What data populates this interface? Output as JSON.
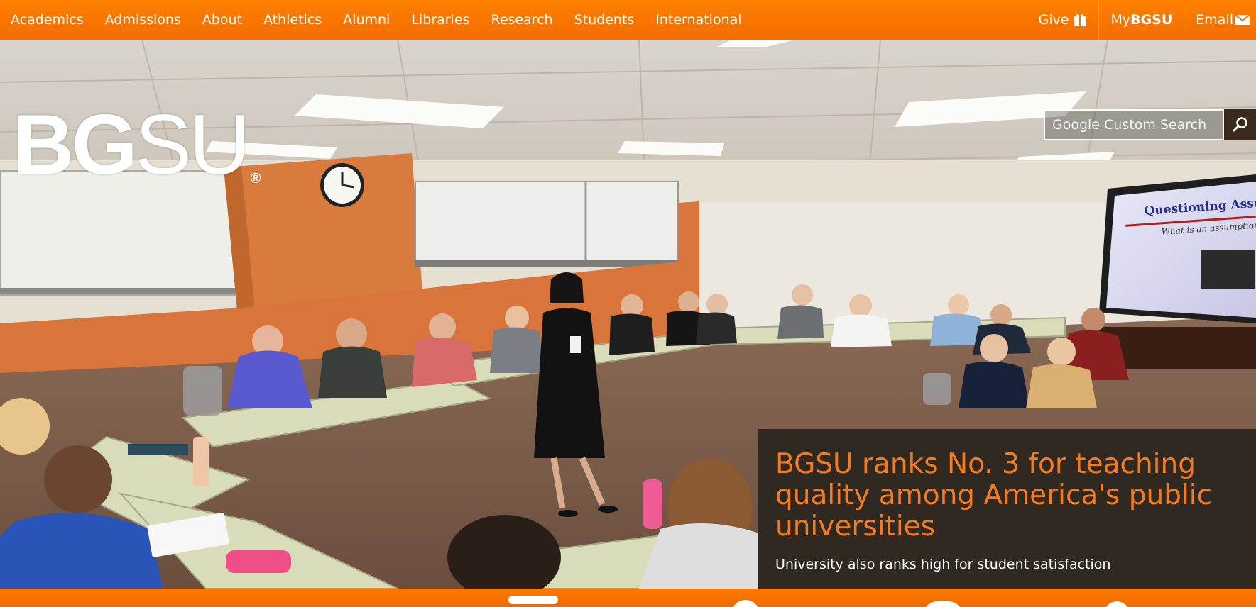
{
  "nav": {
    "left": [
      {
        "label": "Academics"
      },
      {
        "label": "Admissions"
      },
      {
        "label": "About"
      },
      {
        "label": "Athletics"
      },
      {
        "label": "Alumni"
      },
      {
        "label": "Libraries"
      },
      {
        "label": "Research"
      },
      {
        "label": "Students"
      },
      {
        "label": "International"
      }
    ],
    "right": {
      "give_label": "Give",
      "give_icon": "gift-icon",
      "my_prefix": "My",
      "my_strong": "BGSU",
      "email_label": "Email",
      "email_icon": "envelope-icon"
    }
  },
  "logo": {
    "bg": "BG",
    "su": "SU",
    "registered": "®"
  },
  "search": {
    "placeholder": "Google Custom Search",
    "button_icon": "search-icon"
  },
  "feature": {
    "headline": "BGSU ranks No. 3 for teaching quality among America's public universities",
    "subtext": "University also ranks high for student satisfaction"
  },
  "hero": {
    "screen_title": "Questioning Assumpt",
    "screen_subtitle": "What is an assumption?"
  },
  "colors": {
    "brand_orange": "#ff7300",
    "headline_orange": "#f47b20",
    "feature_bg": "#2f2921",
    "search_button_bg": "#3a2a1c"
  }
}
